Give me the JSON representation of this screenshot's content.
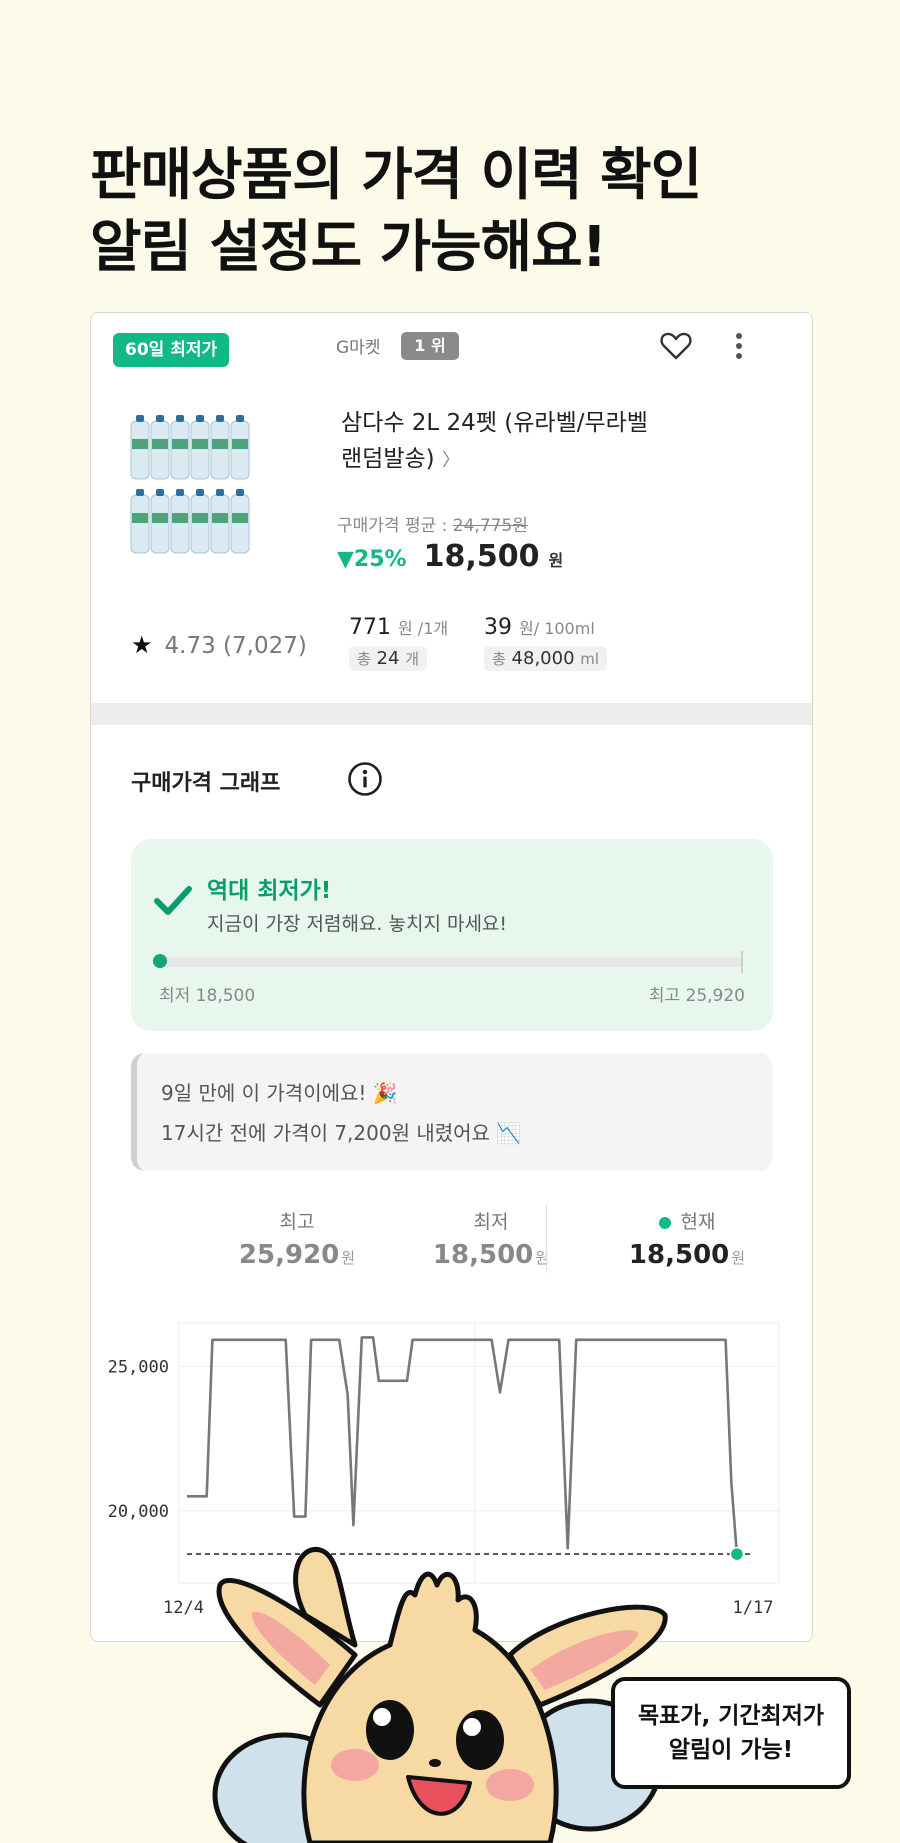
{
  "headline": {
    "line1": "판매상품의 가격 이력 확인",
    "line2": "알림 설정도 가능해요!"
  },
  "product": {
    "badge": "60일 최저가",
    "shop": "G마켓",
    "rank": "1 위",
    "name_line1": "삼다수 2L 24펫 (유라벨/무라벨",
    "name_line2": "랜덤발송)",
    "avg_label": "구매가격 평균 :",
    "avg_price": "24,775원",
    "discount": "▼25%",
    "price": "18,500",
    "price_unit": "원",
    "rating": "4.73 (7,027)",
    "unit_price1": "771",
    "unit_price1_suffix": "원 /1개",
    "unit_total1_prefix": "총",
    "unit_total1": "24",
    "unit_total1_suffix": "개",
    "unit_price2": "39",
    "unit_price2_suffix": "원/ 100ml",
    "unit_total2_prefix": "총",
    "unit_total2": "48,000",
    "unit_total2_suffix": "ml"
  },
  "graph_section": {
    "title": "구매가격 그래프",
    "low_title": "역대 최저가!",
    "low_sub": "지금이 가장 저렴해요. 놓치지 마세요!",
    "range_position": 0.0,
    "range_min": "최저 18,500",
    "range_max": "최고 25,920",
    "note1": "9일 만에 이 가격이에요! 🎉",
    "note2": "17시간 전에 가격이 7,200원 내렸어요 📉"
  },
  "stats": {
    "max_label": "최고",
    "max_value": "25,920",
    "min_label": "최저",
    "min_value": "18,500",
    "cur_label": "현재",
    "cur_value": "18,500",
    "unit": "원"
  },
  "colors": {
    "accent": "#12b886",
    "background": "#fcfbea"
  },
  "chart_data": {
    "type": "line",
    "x_tick_labels": [
      "12/4",
      "1/17"
    ],
    "y_tick_labels": [
      "25,000",
      "20,000"
    ],
    "ylim": [
      17500,
      26500
    ],
    "xlim": [
      0,
      100
    ],
    "reference_line": 18500,
    "series": [
      {
        "values": [
          [
            0,
            20500
          ],
          [
            3.5,
            20500
          ],
          [
            4.5,
            25920
          ],
          [
            17.5,
            25920
          ],
          [
            19,
            19800
          ],
          [
            21,
            19800
          ],
          [
            22,
            25920
          ],
          [
            27,
            25920
          ],
          [
            28.5,
            24000
          ],
          [
            29.5,
            19500
          ],
          [
            31,
            26000
          ],
          [
            33,
            26000
          ],
          [
            34,
            24500
          ],
          [
            39,
            24500
          ],
          [
            40,
            25920
          ],
          [
            54,
            25920
          ],
          [
            55.5,
            24100
          ],
          [
            57,
            25920
          ],
          [
            66,
            25920
          ],
          [
            67.5,
            18700
          ],
          [
            69,
            25920
          ],
          [
            95.5,
            25920
          ],
          [
            96.5,
            21000
          ],
          [
            97.5,
            18500
          ]
        ]
      }
    ]
  },
  "bubble": {
    "line1": "목표가, 기간최저가",
    "line2": "알림이 가능!"
  }
}
